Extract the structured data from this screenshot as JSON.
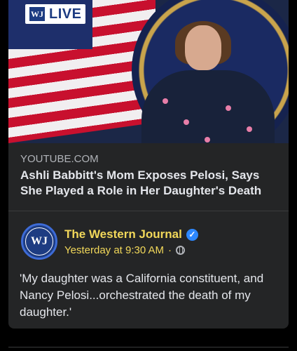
{
  "video": {
    "badge_logo": "WJ",
    "badge_label": "LIVE"
  },
  "link_preview": {
    "domain": "YOUTUBE.COM",
    "title": "Ashli Babbitt's Mom Exposes Pelosi, Says She Played a Role in Her Daughter's Death"
  },
  "post": {
    "page_name": "The Western Journal",
    "avatar_text": "WJ",
    "timestamp": "Yesterday at 9:30 AM",
    "separator": "·",
    "verified_icon": "verified-badge-icon",
    "privacy_icon": "globe-icon",
    "text": "'My daughter was a California constituent, and Nancy Pelosi...orchestrated the death of my daughter.'"
  },
  "colors": {
    "background": "#000000",
    "card": "#242526",
    "accent": "#f2d85a",
    "verified": "#2d88ff"
  }
}
